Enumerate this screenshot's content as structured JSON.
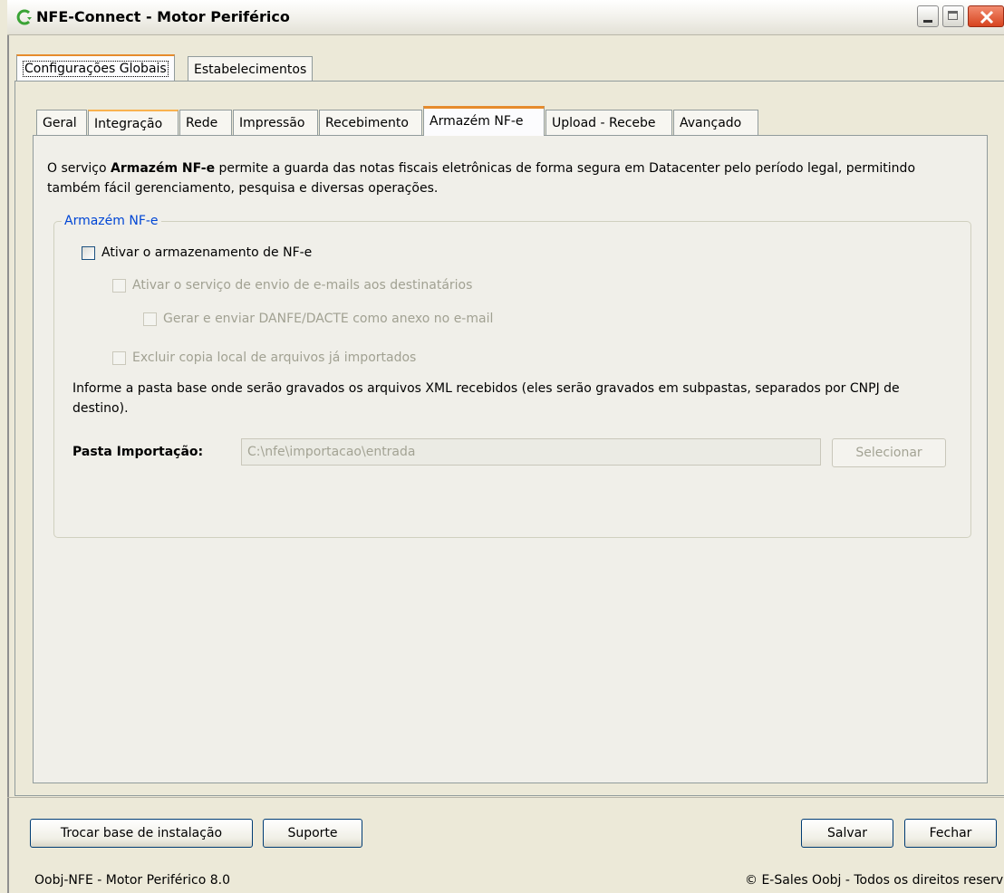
{
  "window": {
    "title": "NFE-Connect - Motor Periférico"
  },
  "outer_tabs": [
    {
      "label": "Configurações Globais",
      "active": true
    },
    {
      "label": "Estabelecimentos",
      "active": false
    }
  ],
  "inner_tabs": [
    {
      "label": "Geral"
    },
    {
      "label": "Integração"
    },
    {
      "label": "Rede"
    },
    {
      "label": "Impressão"
    },
    {
      "label": "Recebimento"
    },
    {
      "label": "Armazém NF-e"
    },
    {
      "label": "Upload - Recebe"
    },
    {
      "label": "Avançado"
    }
  ],
  "active_inner_tab": "Armazém NF-e",
  "description": {
    "prefix": "O serviço ",
    "bold": "Armazém NF-e",
    "suffix": " permite a guarda das notas fiscais eletrônicas de forma segura em Datacenter pelo período legal, permitindo também fácil gerenciamento, pesquisa e diversas operações."
  },
  "group": {
    "title": "Armazém NF-e",
    "checkboxes": {
      "enable_storage": {
        "label": "Ativar o armazenamento de NF-e",
        "checked": false,
        "enabled": true
      },
      "enable_email": {
        "label": "Ativar o serviço de envio de e-mails aos destinatários",
        "checked": false,
        "enabled": false
      },
      "attach_danfe": {
        "label": "Gerar e enviar DANFE/DACTE como anexo no e-mail",
        "checked": false,
        "enabled": false
      },
      "delete_local": {
        "label": "Excluir copia local de arquivos já importados",
        "checked": false,
        "enabled": false
      }
    },
    "info_text": "Informe a pasta base onde serão gravados os arquivos XML recebidos (eles serão gravados em subpastas, separados por CNPJ de destino).",
    "path_label": "Pasta Importação:",
    "path_value": "C:\\nfe\\importacao\\entrada",
    "select_label": "Selecionar"
  },
  "buttons": {
    "change_base": "Trocar base de instalação",
    "support": "Suporte",
    "save": "Salvar",
    "close": "Fechar"
  },
  "status": {
    "left": "Oobj-NFE - Motor Periférico 8.0",
    "right": "© E-Sales Oobj - Todos os direitos reservados"
  },
  "colors": {
    "active_tab_accent": "#e68b2c",
    "group_title": "#0046d5",
    "app_icon": "#3aa335"
  }
}
